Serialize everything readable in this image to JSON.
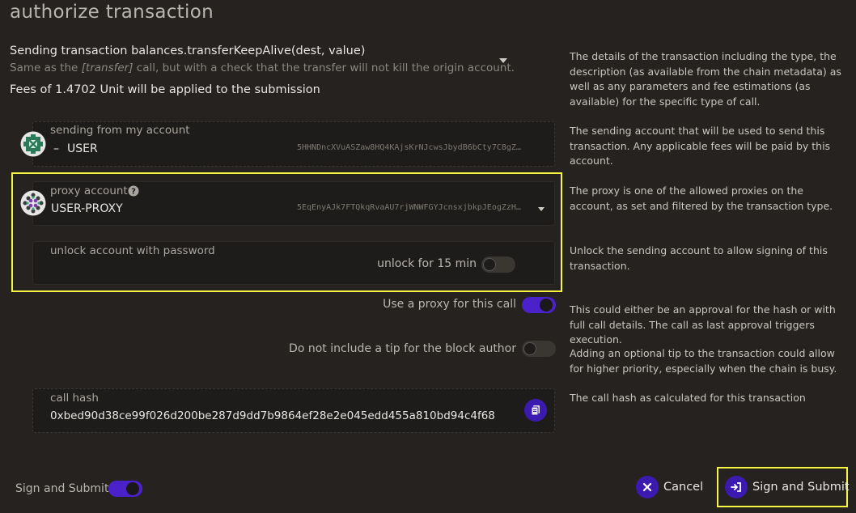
{
  "title": "authorize transaction",
  "transaction": {
    "heading": "Sending transaction balances.transferKeepAlive(dest, value)",
    "desc_prefix": "Same as the ",
    "desc_italic": "[transfer]",
    "desc_suffix": " call, but with a check that the transfer will not kill the origin account.",
    "fees": "Fees of 1.4702 Unit will be applied to the submission"
  },
  "help": {
    "details": "The details of the transaction including the type, the description (as available from the chain metadata) as well as any parameters and fee estimations (as available) for the specific type of call.",
    "sending": "The sending account that will be used to send this transaction. Any applicable fees will be paid by this account.",
    "proxy": "The proxy is one of the allowed proxies on the account, as set and filtered by the transaction type.",
    "unlock": "Unlock the sending account to allow signing of this transaction.",
    "approval": "This could either be an approval for the hash or with full call details. The call as last approval triggers execution.",
    "tip": "Adding an optional tip to the transaction could allow for higher priority, especially when the chain is busy.",
    "hash": "The call hash as calculated for this transaction"
  },
  "sender": {
    "label": "sending from my account",
    "dash": "–",
    "name": "USER",
    "address": "5HHNDncXVuASZaw8HQ4KAjsKrNJcwsJbydB6bCty7C8gZ…"
  },
  "proxy": {
    "label": "proxy account",
    "name": "USER-PROXY",
    "address": "5EqEnyAJk7FTQkqRvaAU7rjWNWFGYJcnsxjbkpJEogZzH…"
  },
  "unlock": {
    "label": "unlock account with password",
    "toggle_label": "unlock for 15 min",
    "toggle_on": false
  },
  "use_proxy": {
    "label": "Use a proxy for this call",
    "on": true
  },
  "no_tip": {
    "label": "Do not include a tip for the block author",
    "on": false
  },
  "call_hash": {
    "label": "call hash",
    "value": "0xbed90d38ce99f026d200be287d9dd7b9864ef28e2e045edd455a810bd94c4f68"
  },
  "footer": {
    "sign_toggle_label": "Sign and Submit",
    "sign_toggle_on": true,
    "cancel_label": "Cancel",
    "submit_label": "Sign and Submit"
  },
  "colors": {
    "accent": "#4a22c9",
    "highlight": "#f5f542",
    "background": "#25221f"
  }
}
